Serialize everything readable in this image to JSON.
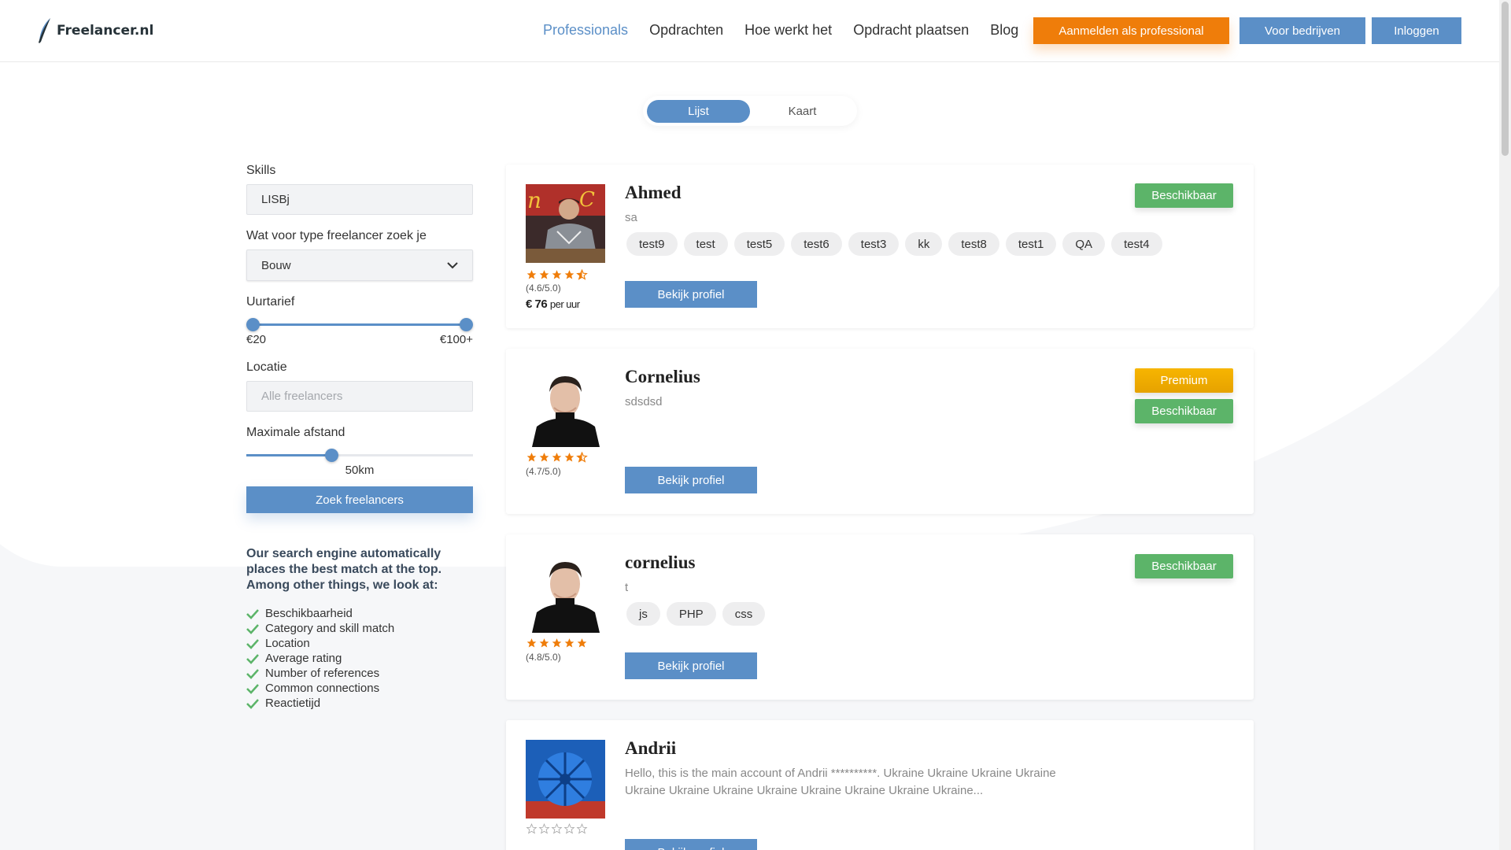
{
  "header": {
    "logo_text": "Freelancer.nl",
    "nav": [
      {
        "label": "Professionals",
        "active": true
      },
      {
        "label": "Opdrachten",
        "active": false
      },
      {
        "label": "Hoe werkt het",
        "active": false
      },
      {
        "label": "Opdracht plaatsen",
        "active": false
      },
      {
        "label": "Blog",
        "active": false
      }
    ],
    "btn_register": "Aanmelden als professional",
    "btn_companies": "Voor bedrijven",
    "btn_login": "Inloggen"
  },
  "view_toggle": {
    "list": "Lijst",
    "map": "Kaart",
    "selected": "Lijst"
  },
  "filters": {
    "skills_label": "Skills",
    "skills_value": "LISBj",
    "type_label": "Wat voor type freelancer zoek je",
    "type_value": "Bouw",
    "rate_label": "Uurtarief",
    "rate_min": "€20",
    "rate_max": "€100+",
    "location_label": "Locatie",
    "location_placeholder": "Alle freelancers",
    "distance_label": "Maximale afstand",
    "distance_value": "50km",
    "distance_fraction": 0.37,
    "search_button": "Zoek freelancers"
  },
  "info": {
    "text": "Our search engine automatically places the best match at the top. Among other things, we look at:",
    "criteria": [
      "Beschikbaarheid",
      "Category and skill match",
      "Location",
      "Average rating",
      "Number of references",
      "Common connections",
      "Reactietijd"
    ]
  },
  "colors": {
    "accent": "#5b8fc7",
    "orange": "#ef7d0a",
    "green": "#5cb469",
    "gold": "#f7b500",
    "star": "#ef7d0a"
  },
  "profiles": [
    {
      "name": "Ahmed",
      "subtitle": "sa",
      "rating": "(4.6/5.0)",
      "stars": 4.5,
      "rate_amount": "€ 76",
      "rate_unit": "per uur",
      "tags": [
        "test9",
        "test",
        "test5",
        "test6",
        "test3",
        "kk",
        "test8",
        "test1",
        "QA",
        "test4"
      ],
      "badges": [
        "Beschikbaar"
      ],
      "button": "Bekijk profiel"
    },
    {
      "name": "Cornelius",
      "subtitle": "sdsdsd",
      "rating": "(4.7/5.0)",
      "stars": 4.5,
      "tags": [],
      "badges": [
        "Premium",
        "Beschikbaar"
      ],
      "button": "Bekijk profiel"
    },
    {
      "name": "cornelius",
      "subtitle": "t",
      "rating": "(4.8/5.0)",
      "stars": 5,
      "tags": [
        "js",
        "PHP",
        "css"
      ],
      "badges": [
        "Beschikbaar"
      ],
      "button": "Bekijk profiel"
    },
    {
      "name": "Andrii",
      "subtitle": "Hello, this is the main account of Andrii **********. Ukraine Ukraine Ukraine Ukraine Ukraine Ukraine Ukraine Ukraine Ukraine Ukraine Ukraine Ukraine...",
      "stars": 0,
      "tags": [],
      "badges": [],
      "button": "Bekijk profiel"
    }
  ]
}
